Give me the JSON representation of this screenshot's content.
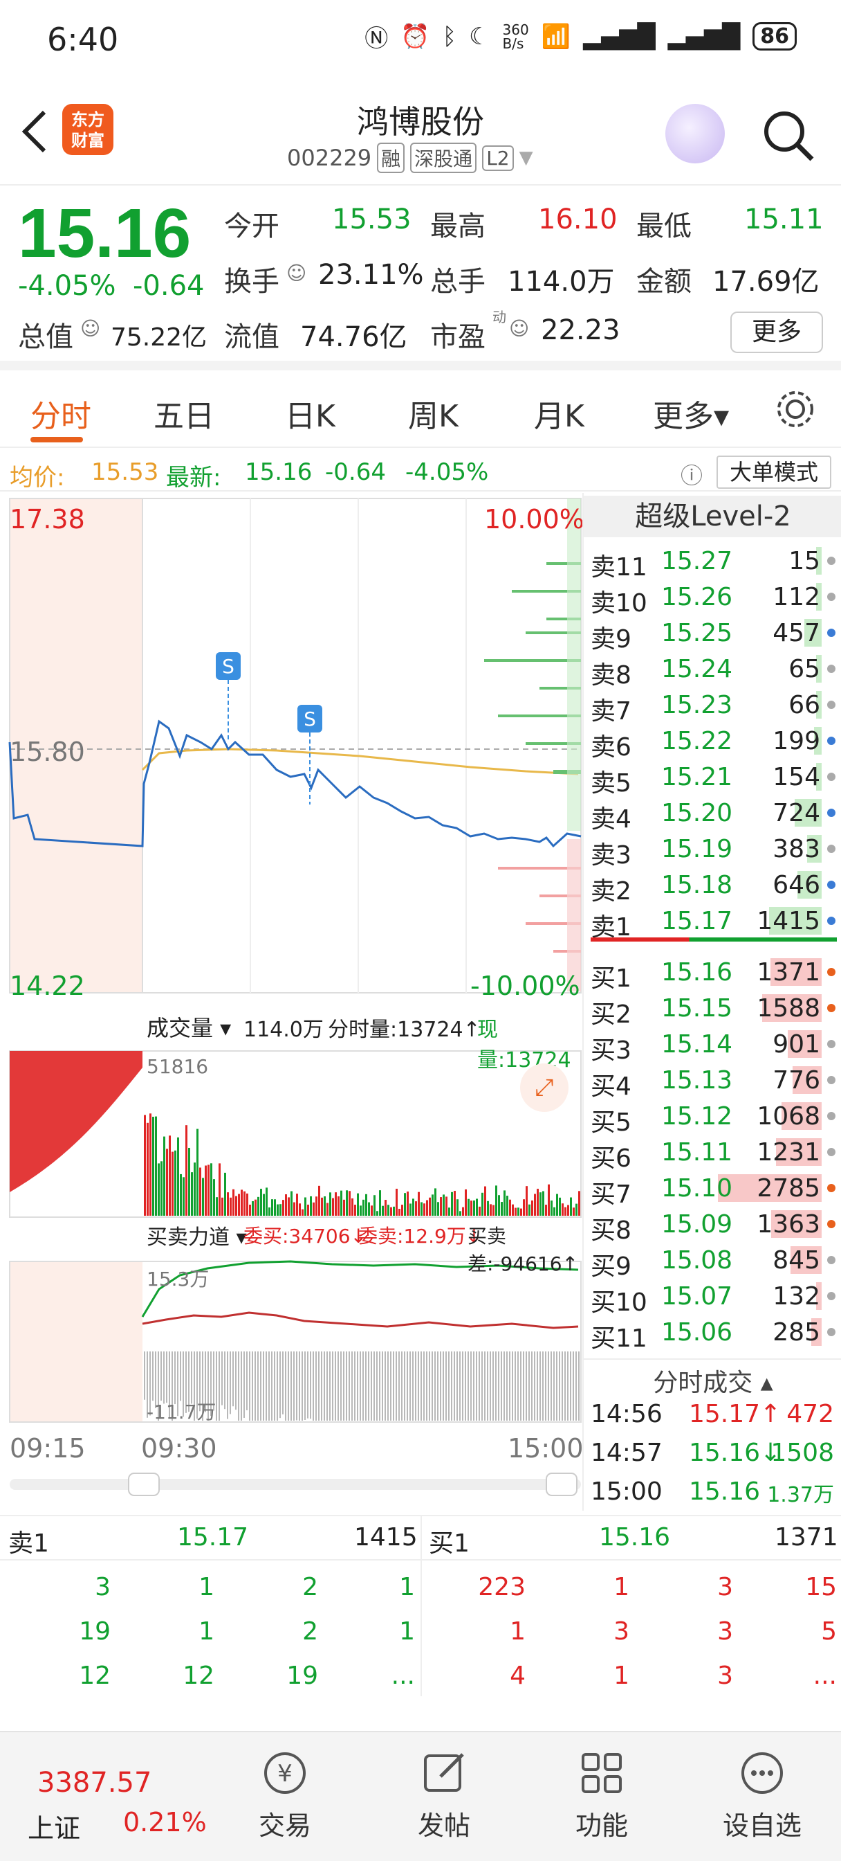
{
  "status": {
    "time": "6:40",
    "net_speed": "360\nB/s",
    "battery": "86"
  },
  "header": {
    "logo_text": "东方\n财富",
    "stock_name": "鸿博股份",
    "stock_code": "002229",
    "tags": [
      "融",
      "深股通",
      "L2"
    ]
  },
  "quote": {
    "price": "15.16",
    "pct": "-4.05%",
    "chg": "-0.64",
    "open_label": "今开",
    "open": "15.53",
    "high_label": "最高",
    "high": "16.10",
    "low_label": "最低",
    "low": "15.11",
    "turnover_label": "换手",
    "turnover": "23.11%",
    "volume_label": "总手",
    "volume": "114.0万",
    "amount_label": "金额",
    "amount": "17.69亿",
    "mktcap_label": "总值",
    "mktcap": "75.22亿",
    "float_label": "流值",
    "float": "74.76亿",
    "pe_label": "市盈",
    "pe_sup": "动",
    "pe": "22.23",
    "more_label": "更多"
  },
  "tabs": [
    {
      "label": "分时",
      "active": true
    },
    {
      "label": "五日"
    },
    {
      "label": "日K"
    },
    {
      "label": "周K"
    },
    {
      "label": "月K"
    },
    {
      "label": "更多▾"
    }
  ],
  "info_line": {
    "avg_label": "均价:",
    "avg": "15.53",
    "latest_label": "最新:",
    "latest": "15.16",
    "latest_chg": "-0.64",
    "latest_pct": "-4.05%",
    "mode_btn": "大单模式"
  },
  "chart": {
    "top_price": "17.38",
    "top_pct": "10.00%",
    "mid_price": "15.80",
    "bottom_price": "14.22",
    "bottom_pct": "-10.00%",
    "volume_label": "成交量 ▾",
    "volume_total": "114.0万",
    "fen_label": "分时量:13724↑",
    "now_label": "现量:13724",
    "volume_max": "51816",
    "force_label": "买卖力道 ▾",
    "weimai": "委买:34706↓",
    "weimai_sell": "委卖:12.9万↓",
    "diff": "买卖差:-94616↑",
    "force_top": "15.3万",
    "force_bottom": "-11.7万",
    "time_start": "09:15",
    "time_open": "09:30",
    "time_end": "15:00",
    "s_marker": "S"
  },
  "order_book": {
    "title": "超级Level-2",
    "sells": [
      {
        "label": "卖11",
        "price": "15.27",
        "vol": "15",
        "color": "#aaa"
      },
      {
        "label": "卖10",
        "price": "15.26",
        "vol": "112",
        "color": "#aaa"
      },
      {
        "label": "卖9",
        "price": "15.25",
        "vol": "457",
        "color": "#3a7bd5"
      },
      {
        "label": "卖8",
        "price": "15.24",
        "vol": "65",
        "color": "#aaa"
      },
      {
        "label": "卖7",
        "price": "15.23",
        "vol": "66",
        "color": "#aaa"
      },
      {
        "label": "卖6",
        "price": "15.22",
        "vol": "199",
        "color": "#3a7bd5"
      },
      {
        "label": "卖5",
        "price": "15.21",
        "vol": "154",
        "color": "#aaa"
      },
      {
        "label": "卖4",
        "price": "15.20",
        "vol": "724",
        "color": "#3a7bd5"
      },
      {
        "label": "卖3",
        "price": "15.19",
        "vol": "383",
        "color": "#aaa"
      },
      {
        "label": "卖2",
        "price": "15.18",
        "vol": "646",
        "color": "#3a7bd5"
      },
      {
        "label": "卖1",
        "price": "15.17",
        "vol": "1415",
        "color": "#3a7bd5"
      }
    ],
    "buys": [
      {
        "label": "买1",
        "price": "15.16",
        "vol": "1371",
        "color": "#e8601c"
      },
      {
        "label": "买2",
        "price": "15.15",
        "vol": "1588",
        "color": "#e8601c"
      },
      {
        "label": "买3",
        "price": "15.14",
        "vol": "901",
        "color": "#aaa"
      },
      {
        "label": "买4",
        "price": "15.13",
        "vol": "776",
        "color": "#aaa"
      },
      {
        "label": "买5",
        "price": "15.12",
        "vol": "1068",
        "color": "#aaa"
      },
      {
        "label": "买6",
        "price": "15.11",
        "vol": "1231",
        "color": "#aaa"
      },
      {
        "label": "买7",
        "price": "15.10",
        "vol": "2785",
        "color": "#e8601c"
      },
      {
        "label": "买8",
        "price": "15.09",
        "vol": "1363",
        "color": "#e8601c"
      },
      {
        "label": "买9",
        "price": "15.08",
        "vol": "845",
        "color": "#aaa"
      },
      {
        "label": "买10",
        "price": "15.07",
        "vol": "132",
        "color": "#aaa"
      },
      {
        "label": "买11",
        "price": "15.06",
        "vol": "285",
        "color": "#aaa"
      }
    ],
    "ticks_title": "分时成交 ▴",
    "ticks": [
      {
        "time": "14:56",
        "price": "15.17",
        "arrow": "↑",
        "vol": "472",
        "color": "#e02424",
        "vcolor": "#e02424"
      },
      {
        "time": "14:57",
        "price": "15.16",
        "arrow": "↓",
        "vol": "1508",
        "color": "#11a030",
        "vcolor": "#11a030"
      },
      {
        "time": "15:00",
        "price": "15.16",
        "arrow": "",
        "vol": "1.37万",
        "color": "#11a030",
        "vcolor": "#11a030"
      }
    ]
  },
  "queue": {
    "sell_label": "卖1",
    "sell_price": "15.17",
    "sell_vol": "1415",
    "buy_label": "买1",
    "buy_price": "15.16",
    "buy_vol": "1371",
    "sell_rows": [
      [
        "3",
        "1",
        "2",
        "1"
      ],
      [
        "19",
        "1",
        "2",
        "1"
      ],
      [
        "12",
        "12",
        "19",
        "..."
      ]
    ],
    "buy_rows": [
      [
        "223",
        "1",
        "3",
        "15"
      ],
      [
        "1",
        "3",
        "3",
        "5"
      ],
      [
        "4",
        "1",
        "3",
        "..."
      ]
    ]
  },
  "bottom_nav": {
    "index_value": "3387.57",
    "index_name": "上证",
    "index_pct": "0.21%",
    "items": [
      "交易",
      "发帖",
      "功能",
      "设自选"
    ]
  }
}
